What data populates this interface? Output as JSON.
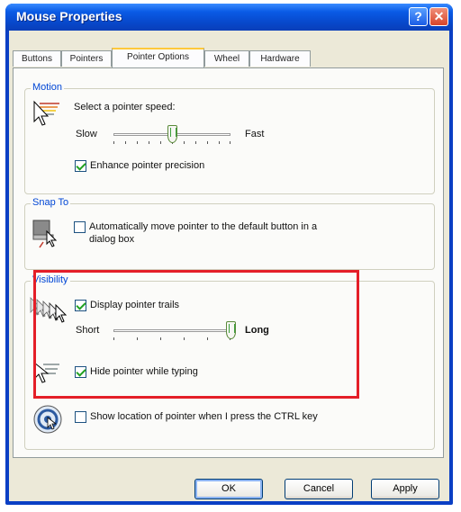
{
  "window": {
    "title": "Mouse Properties"
  },
  "titlebar_buttons": {
    "help": "?",
    "close": "✕"
  },
  "tabs": [
    {
      "label": "Buttons"
    },
    {
      "label": "Pointers"
    },
    {
      "label": "Pointer Options",
      "active": true
    },
    {
      "label": "Wheel"
    },
    {
      "label": "Hardware"
    }
  ],
  "motion": {
    "legend": "Motion",
    "prompt": "Select a pointer speed:",
    "slow_label": "Slow",
    "fast_label": "Fast",
    "speed_level": 0.5,
    "enhance_label": "Enhance pointer precision",
    "enhance_checked": true
  },
  "snap_to": {
    "legend": "Snap To",
    "label_line1": "Automatically move pointer to the default button in a",
    "label_line2": "dialog box",
    "checked": false
  },
  "visibility": {
    "legend": "Visibility",
    "trails_label": "Display pointer trails",
    "trails_checked": true,
    "short_label": "Short",
    "long_label": "Long",
    "trail_length_level": 1.0,
    "hide_label": "Hide pointer while typing",
    "hide_checked": true,
    "show_location_label": "Show location of pointer when I press the CTRL key",
    "show_location_checked": false
  },
  "buttons": {
    "ok": "OK",
    "cancel": "Cancel",
    "apply": "Apply"
  },
  "colors": {
    "highlight": "#e41e28",
    "titlebar": "#0a5be6",
    "legend": "#0046d5"
  }
}
